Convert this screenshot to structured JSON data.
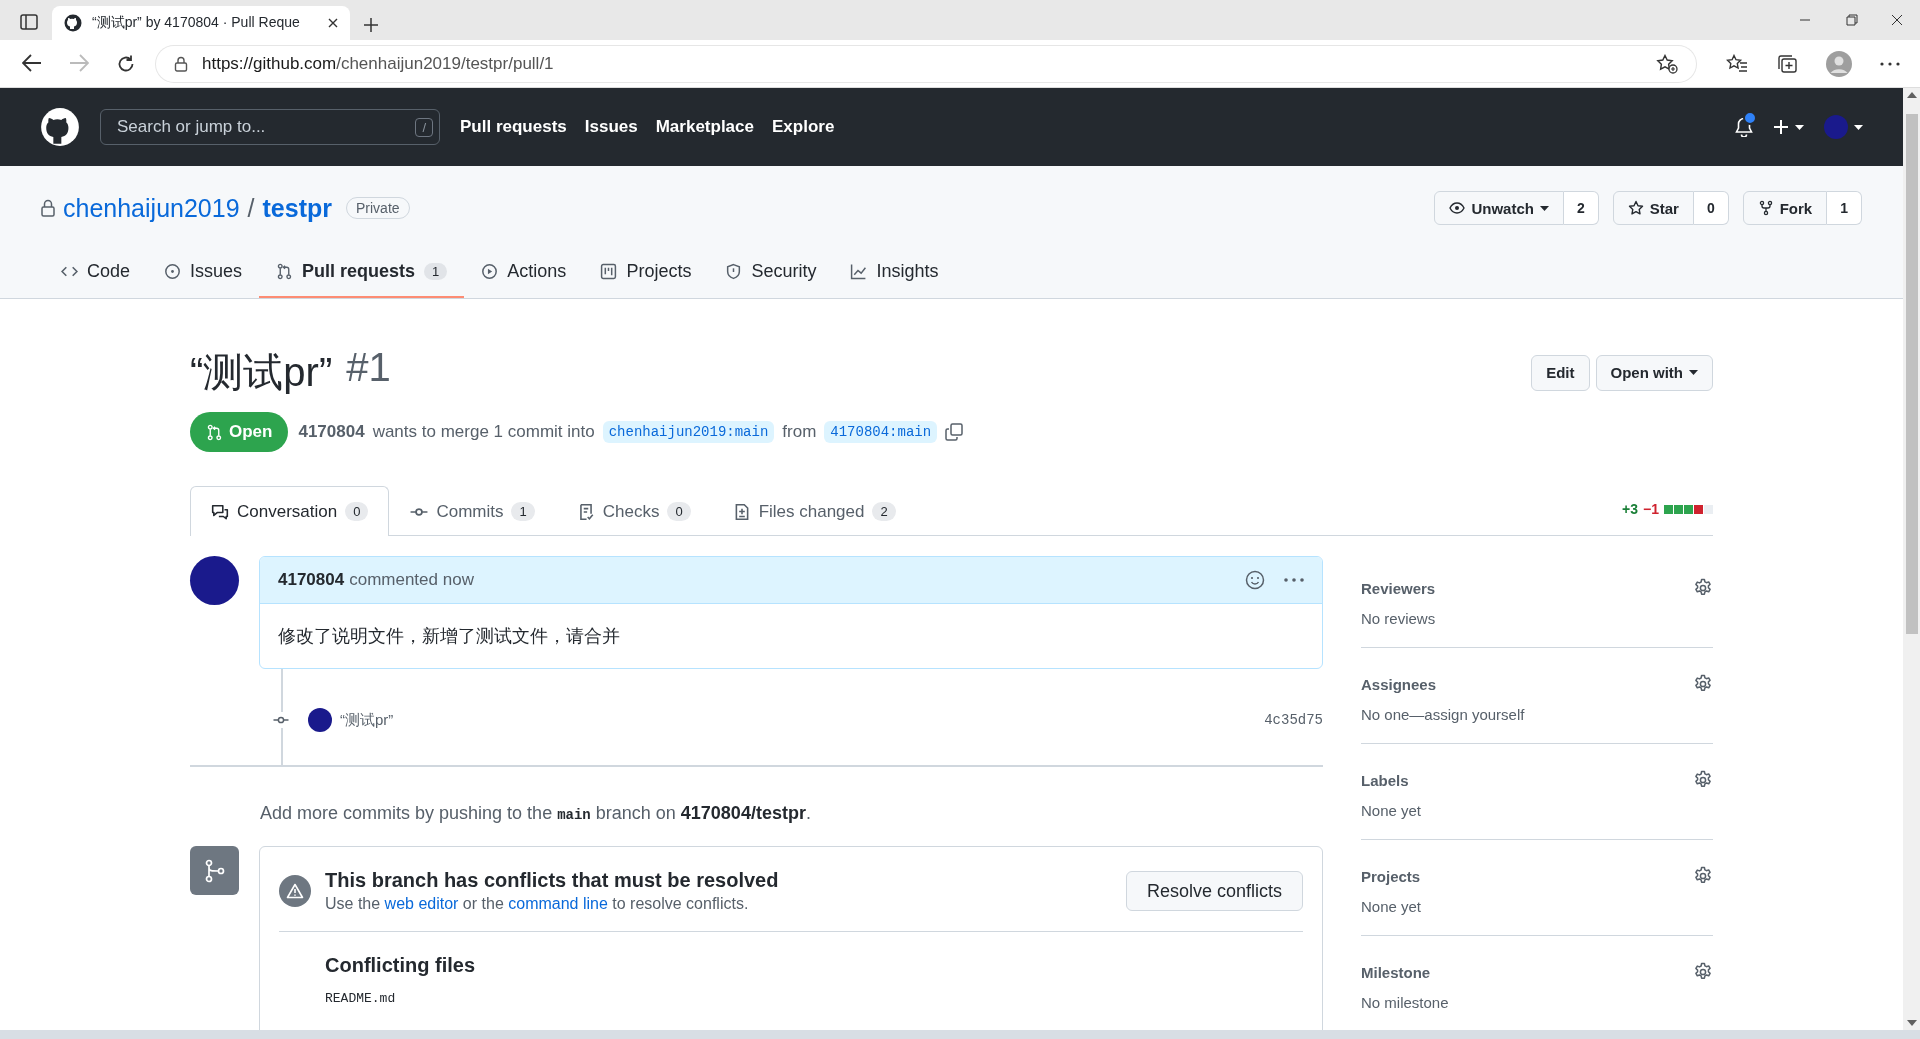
{
  "browser": {
    "tab_title": "“测试pr” by 4170804 · Pull Reque",
    "url_host": "https://github.com",
    "url_path": "/chenhaijun2019/testpr/pull/1"
  },
  "header": {
    "search_placeholder": "Search or jump to...",
    "search_key": "/",
    "nav": [
      "Pull requests",
      "Issues",
      "Marketplace",
      "Explore"
    ],
    "notification_unread": true
  },
  "repo": {
    "owner": "chenhaijun2019",
    "separator": "/",
    "name": "testpr",
    "visibility": "Private",
    "actions": [
      {
        "kind": "watch",
        "label": "Unwatch",
        "count": "2",
        "dropdown": true
      },
      {
        "kind": "star",
        "label": "Star",
        "count": "0",
        "dropdown": false
      },
      {
        "kind": "fork",
        "label": "Fork",
        "count": "1",
        "dropdown": false
      }
    ],
    "tabs": [
      {
        "kind": "code",
        "label": "Code",
        "selected": false
      },
      {
        "kind": "issues",
        "label": "Issues",
        "selected": false
      },
      {
        "kind": "pulls",
        "label": "Pull requests",
        "counter": "1",
        "selected": true
      },
      {
        "kind": "actions",
        "label": "Actions",
        "selected": false
      },
      {
        "kind": "projects",
        "label": "Projects",
        "selected": false
      },
      {
        "kind": "security",
        "label": "Security",
        "selected": false
      },
      {
        "kind": "insights",
        "label": "Insights",
        "selected": false
      }
    ]
  },
  "pull_request": {
    "title": "“测试pr”",
    "number": "#1",
    "state": "Open",
    "author": "4170804",
    "summary": "wants to merge 1 commit into",
    "base": "chenhaijun2019:main",
    "from_word": "from",
    "head": "4170804:main",
    "edit_button": "Edit",
    "open_with_button": "Open with",
    "tabs": [
      {
        "kind": "conversation",
        "label": "Conversation",
        "counter": "0",
        "selected": true
      },
      {
        "kind": "commits",
        "label": "Commits",
        "counter": "1",
        "selected": false
      },
      {
        "kind": "checks",
        "label": "Checks",
        "counter": "0",
        "selected": false
      },
      {
        "kind": "files",
        "label": "Files changed",
        "counter": "2",
        "selected": false
      }
    ],
    "diffstat": {
      "additions": "+3",
      "deletions": "−1",
      "blocks": [
        {
          "kind": "added"
        },
        {
          "kind": "added"
        },
        {
          "kind": "added"
        },
        {
          "kind": "deleted"
        },
        {
          "kind": "neutral"
        }
      ]
    }
  },
  "comment": {
    "author": "4170804",
    "meta": "commented now",
    "body": "修改了说明文件，新增了测试文件，请合并"
  },
  "commit": {
    "message": "“测试pr”",
    "sha": "4c35d75"
  },
  "push_hint": {
    "before": "Add more commits by pushing to the",
    "branch": "main",
    "middle": "branch on",
    "repo": "4170804/testpr",
    "after": "."
  },
  "merge_box": {
    "title": "This branch has conflicts that must be resolved",
    "text_before": "Use the",
    "link_1": "web editor",
    "text_middle": "or the",
    "link_2": "command line",
    "text_after": "to resolve conflicts.",
    "button": "Resolve conflicts",
    "files_title": "Conflicting files",
    "files": [
      "README.md"
    ]
  },
  "sidebar": [
    {
      "title": "Reviewers",
      "value": "No reviews"
    },
    {
      "title": "Assignees",
      "value": "No one—assign yourself"
    },
    {
      "title": "Labels",
      "value": "None yet"
    },
    {
      "title": "Projects",
      "value": "None yet"
    },
    {
      "title": "Milestone",
      "value": "No milestone"
    }
  ]
}
